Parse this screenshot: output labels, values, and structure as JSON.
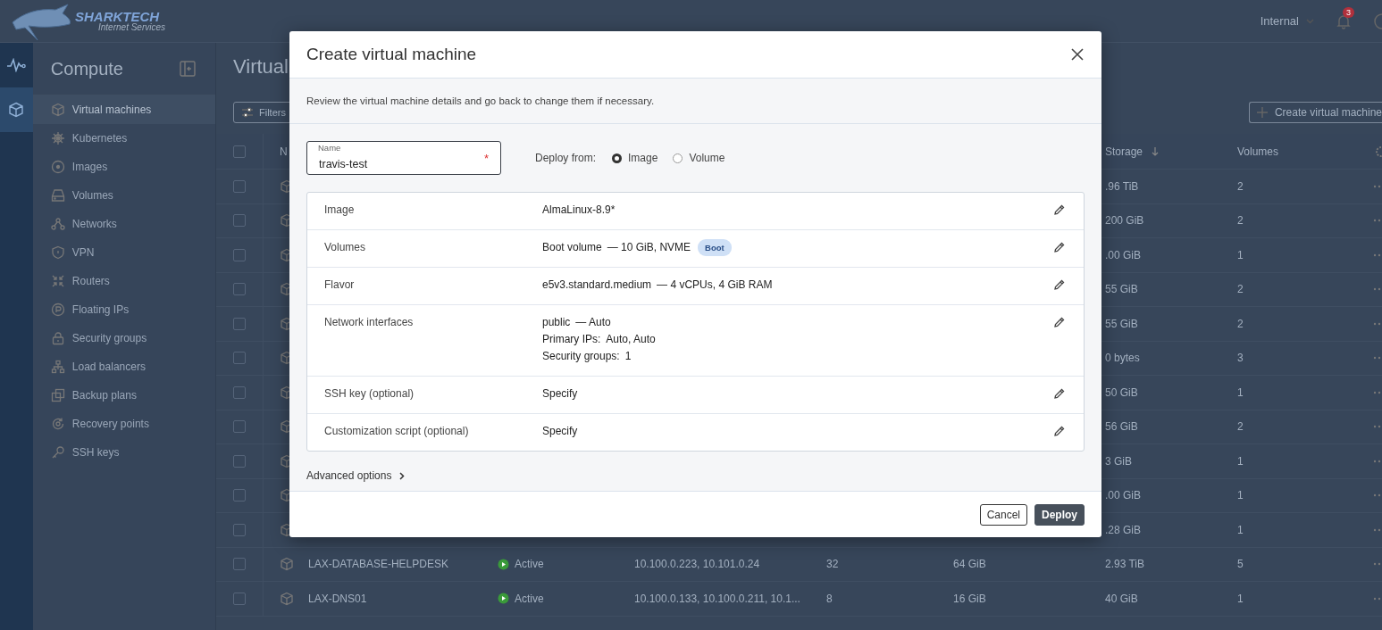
{
  "header": {
    "logo_text": "SHARKTECH",
    "logo_subtext": "Internet Services",
    "project": "Internal",
    "notifications": "3"
  },
  "rail": [
    {
      "kind": "activity",
      "selected": false
    },
    {
      "kind": "compute",
      "selected": true
    }
  ],
  "sidebar": {
    "title": "Compute",
    "items": [
      {
        "label": "Virtual machines",
        "kind": "cube",
        "selected": true
      },
      {
        "label": "Kubernetes",
        "kind": "helm",
        "selected": false
      },
      {
        "label": "Images",
        "kind": "disc",
        "selected": false
      },
      {
        "label": "Volumes",
        "kind": "drive",
        "selected": false
      },
      {
        "label": "Networks",
        "kind": "network",
        "selected": false
      },
      {
        "label": "VPN",
        "kind": "shield",
        "selected": false
      },
      {
        "label": "Routers",
        "kind": "routers",
        "selected": false
      },
      {
        "label": "Floating IPs",
        "kind": "floating",
        "selected": false
      },
      {
        "label": "Security groups",
        "kind": "lock",
        "selected": false
      },
      {
        "label": "Load balancers",
        "kind": "hierarchy",
        "selected": false
      },
      {
        "label": "Backup plans",
        "kind": "stack",
        "selected": false
      },
      {
        "label": "Recovery points",
        "kind": "recovery",
        "selected": false
      },
      {
        "label": "SSH keys",
        "kind": "key",
        "selected": false
      }
    ]
  },
  "main": {
    "title": "Virtual",
    "filters_button": "Filters",
    "create_button": "Create virtual machine"
  },
  "table": {
    "headers": {
      "name": "N",
      "storage": "Storage",
      "volumes": "Volumes"
    },
    "select_all_checked": false,
    "rows": [
      {
        "storage": ".96 TiB",
        "volumes": "2",
        "checked": false
      },
      {
        "storage": "200 GiB",
        "volumes": "2",
        "checked": false
      },
      {
        "storage": ".00 GiB",
        "volumes": "1",
        "checked": false
      },
      {
        "storage": "55 GiB",
        "volumes": "2",
        "checked": false
      },
      {
        "storage": "55 GiB",
        "volumes": "2",
        "checked": false
      },
      {
        "storage": "0 bytes",
        "volumes": "3",
        "checked": false
      },
      {
        "storage": "50 GiB",
        "volumes": "1",
        "checked": false
      },
      {
        "storage": "56 GiB",
        "volumes": "2",
        "checked": false
      },
      {
        "storage": "3 GiB",
        "volumes": "1",
        "checked": false
      },
      {
        "storage": ".00 GiB",
        "volumes": "1",
        "checked": false
      },
      {
        "storage": ".28 GiB",
        "volumes": "1",
        "checked": false
      },
      {
        "checked": false,
        "name": "LAX-DATABASE-HELPDESK",
        "status": "Active",
        "ips": "10.100.0.223, 10.101.0.24",
        "vcpus": "32",
        "ram": "64 GiB",
        "storage": "2.93 TiB",
        "volumes": "5"
      },
      {
        "checked": false,
        "name": "LAX-DNS01",
        "status": "Active",
        "ips": "10.100.0.133, 10.100.0.211, 10.1...",
        "vcpus": "8",
        "ram": "16 GiB",
        "storage": "40 GiB",
        "volumes": "1"
      }
    ]
  },
  "modal": {
    "title": "Create virtual machine",
    "description": "Review the virtual machine details and go back to change them if necessary.",
    "name_field": {
      "label": "Name",
      "value": "travis-test",
      "required_mark": "*"
    },
    "deploy_from": {
      "label": "Deploy from:",
      "options": [
        {
          "label": "Image",
          "selected": true
        },
        {
          "label": "Volume",
          "selected": false
        }
      ]
    },
    "summary": [
      {
        "label": "Image",
        "lines": [
          {
            "text": "AlmaLinux-8.9*"
          }
        ]
      },
      {
        "label": "Volumes",
        "lines": [
          {
            "text": "Boot volume",
            "detail": "— 10 GiB, NVME",
            "badge": "Boot"
          }
        ]
      },
      {
        "label": "Flavor",
        "lines": [
          {
            "text": "e5v3.standard.medium",
            "detail": "— 4 vCPUs, 4 GiB RAM"
          }
        ]
      },
      {
        "label": "Network interfaces",
        "lines": [
          {
            "text": "public",
            "detail": "— Auto"
          },
          {
            "text": "Primary IPs:",
            "detail": "Auto, Auto"
          },
          {
            "text": "Security groups:",
            "detail": "1"
          }
        ]
      },
      {
        "label": "SSH key (optional)",
        "lines": [
          {
            "text": "Specify"
          }
        ]
      },
      {
        "label": "Customization script (optional)",
        "lines": [
          {
            "text": "Specify"
          }
        ]
      }
    ],
    "advanced_options": "Advanced options",
    "buttons": [
      {
        "label": "Cancel",
        "kind": "secondary"
      },
      {
        "label": "Deploy",
        "kind": "primary"
      }
    ]
  }
}
